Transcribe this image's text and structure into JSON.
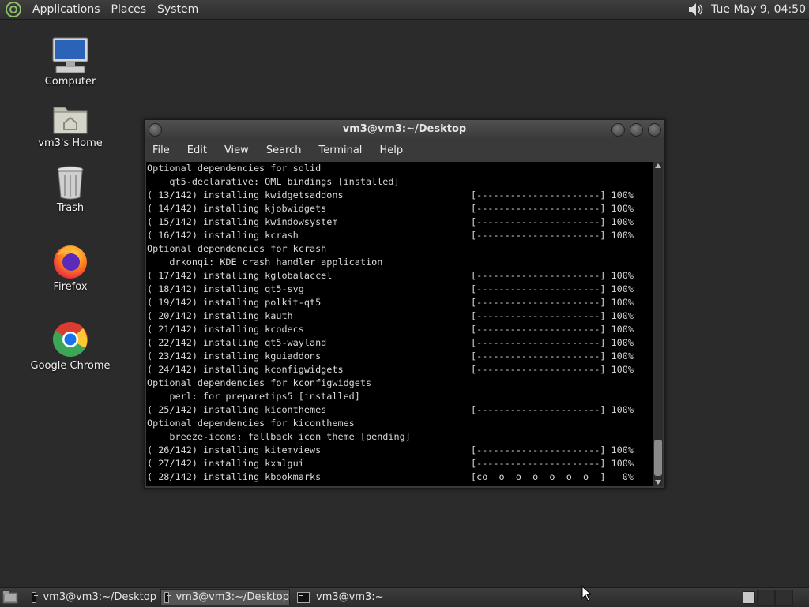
{
  "top_panel": {
    "menus": [
      "Applications",
      "Places",
      "System"
    ],
    "clock": "Tue May  9, 04:50"
  },
  "desktop_icons": [
    {
      "label": "Computer",
      "icon": "computer-icon"
    },
    {
      "label": "vm3's Home",
      "icon": "home-folder-icon"
    },
    {
      "label": "Trash",
      "icon": "trash-icon"
    },
    {
      "label": "Firefox",
      "icon": "firefox-icon"
    },
    {
      "label": "Google Chrome",
      "icon": "chrome-icon"
    }
  ],
  "terminal": {
    "title": "vm3@vm3:~/Desktop",
    "menus": [
      "File",
      "Edit",
      "View",
      "Search",
      "Terminal",
      "Help"
    ],
    "lines": [
      {
        "left": "Optional dependencies for solid",
        "right": ""
      },
      {
        "left": "    qt5-declarative: QML bindings [installed]",
        "right": ""
      },
      {
        "left": "( 13/142) installing kwidgetsaddons",
        "right": "[----------------------] 100%"
      },
      {
        "left": "( 14/142) installing kjobwidgets",
        "right": "[----------------------] 100%"
      },
      {
        "left": "( 15/142) installing kwindowsystem",
        "right": "[----------------------] 100%"
      },
      {
        "left": "( 16/142) installing kcrash",
        "right": "[----------------------] 100%"
      },
      {
        "left": "Optional dependencies for kcrash",
        "right": ""
      },
      {
        "left": "    drkonqi: KDE crash handler application",
        "right": ""
      },
      {
        "left": "( 17/142) installing kglobalaccel",
        "right": "[----------------------] 100%"
      },
      {
        "left": "( 18/142) installing qt5-svg",
        "right": "[----------------------] 100%"
      },
      {
        "left": "( 19/142) installing polkit-qt5",
        "right": "[----------------------] 100%"
      },
      {
        "left": "( 20/142) installing kauth",
        "right": "[----------------------] 100%"
      },
      {
        "left": "( 21/142) installing kcodecs",
        "right": "[----------------------] 100%"
      },
      {
        "left": "( 22/142) installing qt5-wayland",
        "right": "[----------------------] 100%"
      },
      {
        "left": "( 23/142) installing kguiaddons",
        "right": "[----------------------] 100%"
      },
      {
        "left": "( 24/142) installing kconfigwidgets",
        "right": "[----------------------] 100%"
      },
      {
        "left": "Optional dependencies for kconfigwidgets",
        "right": ""
      },
      {
        "left": "    perl: for preparetips5 [installed]",
        "right": ""
      },
      {
        "left": "( 25/142) installing kiconthemes",
        "right": "[----------------------] 100%"
      },
      {
        "left": "Optional dependencies for kiconthemes",
        "right": ""
      },
      {
        "left": "    breeze-icons: fallback icon theme [pending]",
        "right": ""
      },
      {
        "left": "( 26/142) installing kitemviews",
        "right": "[----------------------] 100%"
      },
      {
        "left": "( 27/142) installing kxmlgui",
        "right": "[----------------------] 100%"
      },
      {
        "left": "( 28/142) installing kbookmarks",
        "right": "[co  o  o  o  o  o  o  ]   0%"
      }
    ]
  },
  "taskbar": {
    "tasks": [
      {
        "label": "vm3@vm3:~/Desktop",
        "active": false
      },
      {
        "label": "vm3@vm3:~/Desktop",
        "active": true
      },
      {
        "label": "vm3@vm3:~",
        "active": false
      }
    ]
  }
}
